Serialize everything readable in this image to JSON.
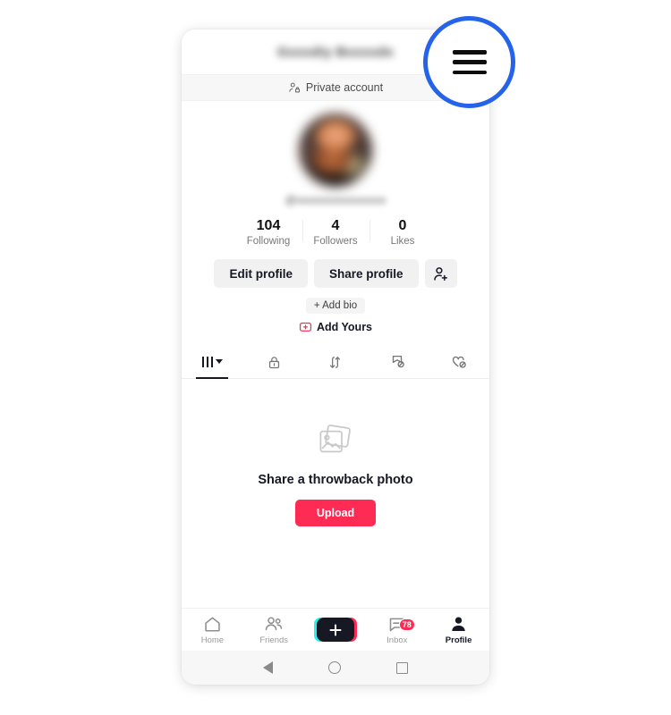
{
  "header": {
    "username_redacted": "Gxxxdiy Bxxxxdx",
    "menu_icon": "hamburger-menu-icon",
    "private_account_label": "Private account",
    "private_account_icon": "person-lock-icon"
  },
  "profile": {
    "avatar_icon": "profile-avatar-blurred",
    "handle_redacted": "@xxxxxxxxxxxxxxxx",
    "stats": [
      {
        "value": "104",
        "label": "Following"
      },
      {
        "value": "4",
        "label": "Followers"
      },
      {
        "value": "0",
        "label": "Likes"
      }
    ],
    "actions": {
      "edit_profile": "Edit profile",
      "share_profile": "Share profile",
      "add_friends_icon": "person-add-icon"
    },
    "add_bio": "+ Add bio",
    "add_yours": "Add Yours",
    "add_yours_icon": "camera-plus-icon"
  },
  "tabs": [
    {
      "name": "posts",
      "icon": "grid-bars-icon",
      "active": true,
      "has_caret": true
    },
    {
      "name": "private",
      "icon": "lock-icon",
      "active": false
    },
    {
      "name": "reposts",
      "icon": "repost-arrows-icon",
      "active": false
    },
    {
      "name": "saved",
      "icon": "bookmark-off-icon",
      "active": false
    },
    {
      "name": "liked",
      "icon": "heart-off-icon",
      "active": false
    }
  ],
  "empty_state": {
    "icon": "stacked-photos-icon",
    "title": "Share a throwback photo",
    "upload_label": "Upload"
  },
  "bottom_nav": [
    {
      "name": "home",
      "label": "Home",
      "icon": "home-icon",
      "active": false
    },
    {
      "name": "friends",
      "label": "Friends",
      "icon": "friends-icon",
      "active": false
    },
    {
      "name": "create",
      "label": "",
      "icon": "plus-create-icon",
      "active": false
    },
    {
      "name": "inbox",
      "label": "Inbox",
      "icon": "inbox-message-icon",
      "active": false,
      "badge": "78"
    },
    {
      "name": "profile",
      "label": "Profile",
      "icon": "person-filled-icon",
      "active": true
    }
  ],
  "system_nav": {
    "back_icon": "android-back-icon",
    "home_icon": "android-home-icon",
    "recents_icon": "android-recents-icon"
  },
  "annotation": {
    "target_icon": "hamburger-menu-icon",
    "circle_color": "#2563eb"
  },
  "colors": {
    "accent_red": "#fe2c55",
    "accent_cyan": "#25f4ee",
    "text_primary": "#161823",
    "text_muted": "#787878",
    "button_gray": "#f1f1f2",
    "annotation_blue": "#2563eb"
  }
}
